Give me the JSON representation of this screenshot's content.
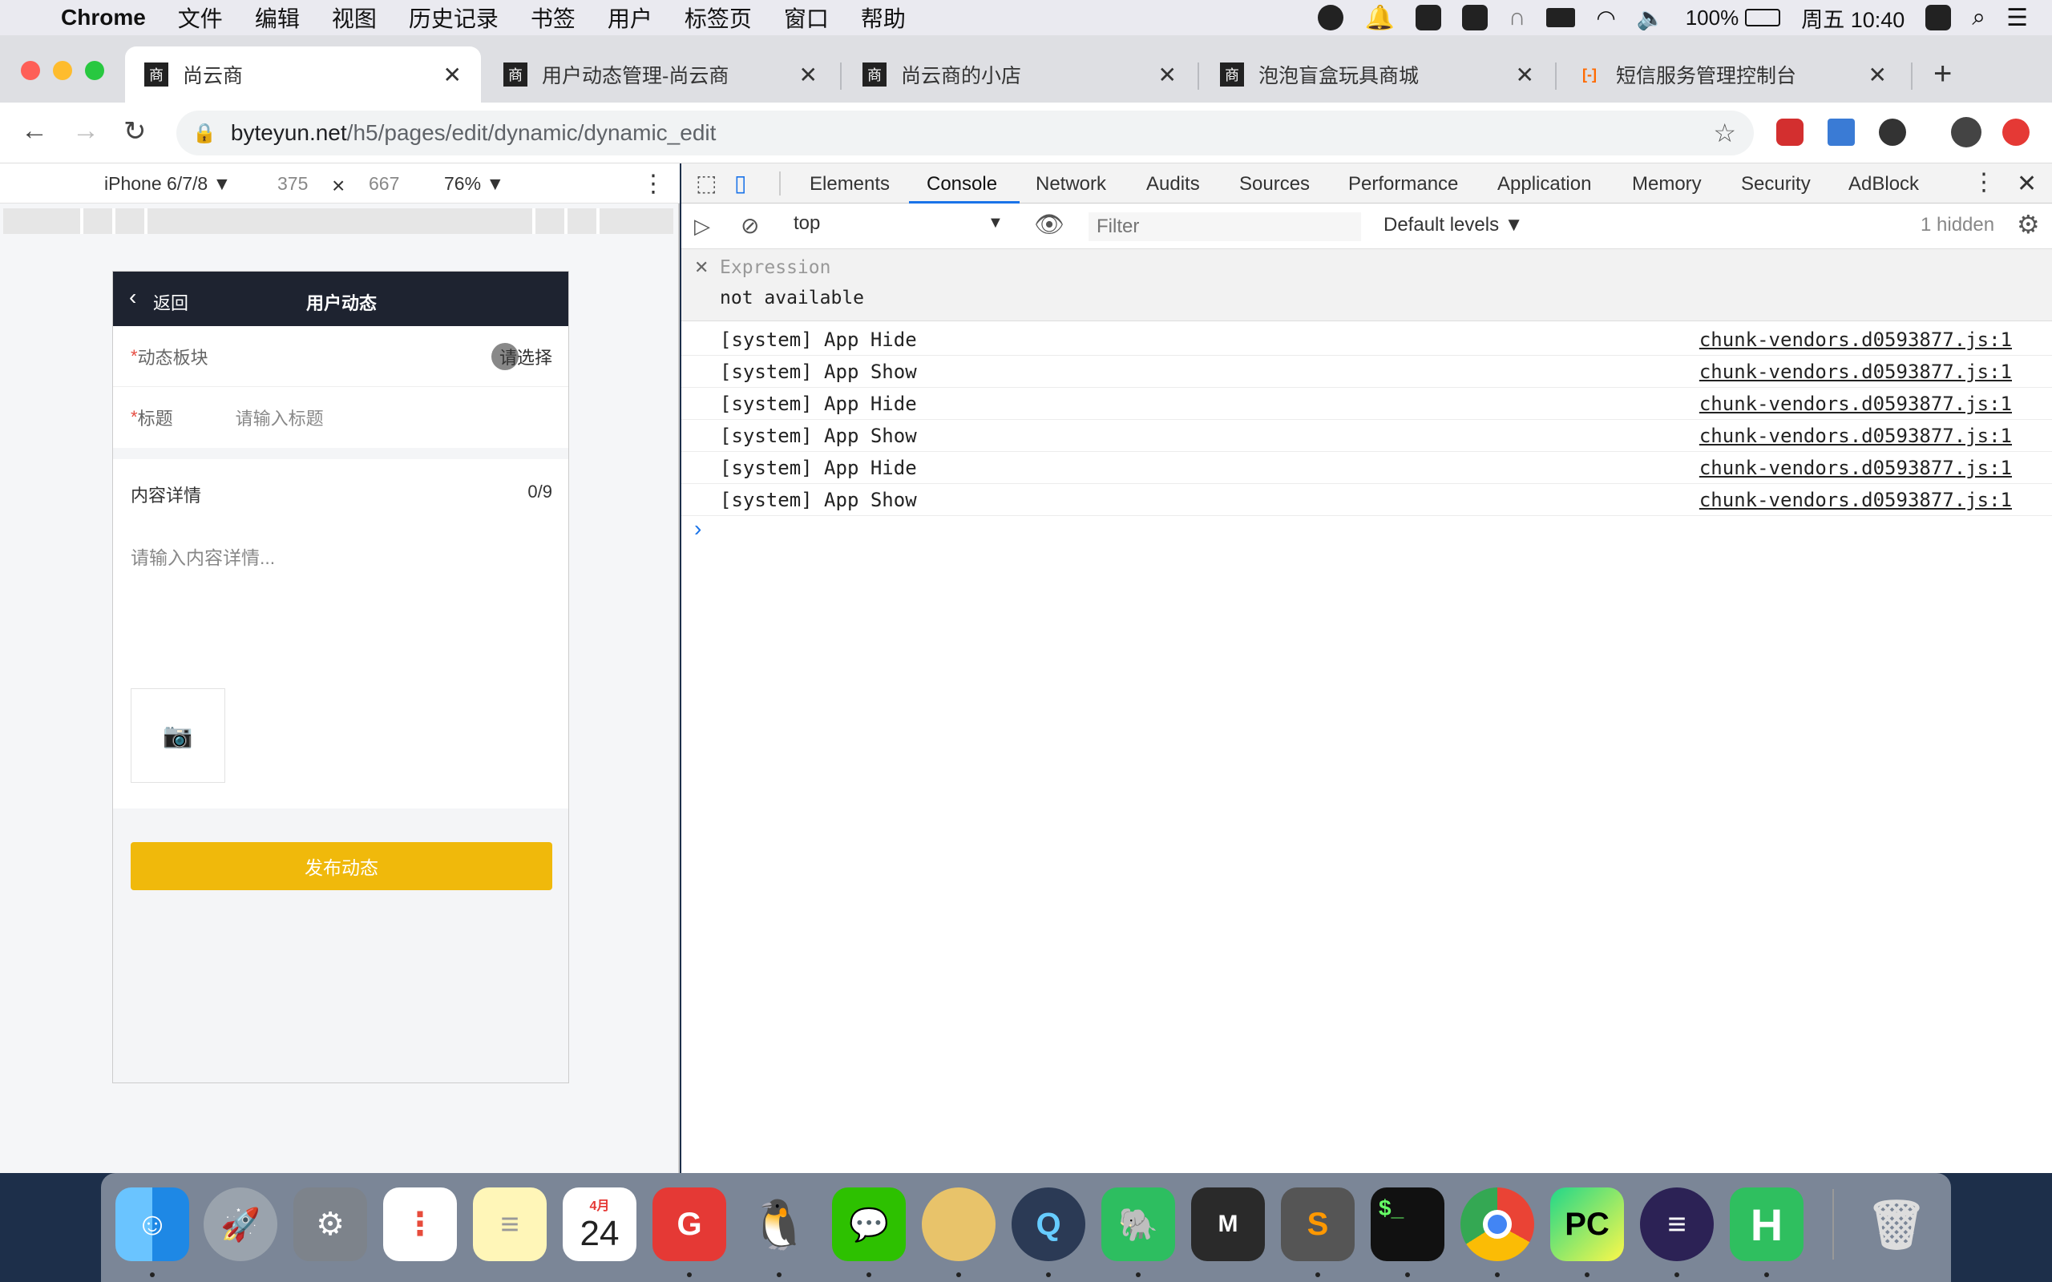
{
  "menubar": {
    "apple": "",
    "app": "Chrome",
    "items": [
      "文件",
      "编辑",
      "视图",
      "历史记录",
      "书签",
      "用户",
      "标签页",
      "窗口",
      "帮助"
    ],
    "battery": "100%",
    "clock": "周五 10:40"
  },
  "tabs": [
    {
      "title": "尚云商",
      "favicon": "商"
    },
    {
      "title": "用户动态管理-尚云商",
      "favicon": "商"
    },
    {
      "title": "尚云商的小店",
      "favicon": "商"
    },
    {
      "title": "泡泡盲盒玩具商城",
      "favicon": "商"
    },
    {
      "title": "短信服务管理控制台",
      "favicon": "[-]"
    }
  ],
  "url": {
    "host": "byteyun.net",
    "path": "/h5/pages/edit/dynamic/dynamic_edit"
  },
  "device_toolbar": {
    "device": "iPhone 6/7/8 ▼",
    "width": "375",
    "x": "×",
    "height": "667",
    "zoom": "76% ▼"
  },
  "phone": {
    "back": "返回",
    "title": "用户动态",
    "section_label": "动态板块",
    "section_value": "请选择",
    "title_label": "标题",
    "title_placeholder": "请输入标题",
    "content_label": "内容详情",
    "content_count": "0/9",
    "content_placeholder": "请输入内容详情...",
    "publish": "发布动态",
    "required": "*"
  },
  "devtools": {
    "tabs": [
      "Elements",
      "Console",
      "Network",
      "Audits",
      "Sources",
      "Performance",
      "Application",
      "Memory",
      "Security",
      "AdBlock"
    ],
    "active_tab": "Console",
    "context": "top",
    "filter_placeholder": "Filter",
    "levels": "Default levels ▼",
    "hidden": "1 hidden",
    "expression_label": "Expression",
    "expression_value": "not available",
    "logs": [
      {
        "msg": "[system] App Hide",
        "src": "chunk-vendors.d0593877.js:1"
      },
      {
        "msg": "[system] App Show",
        "src": "chunk-vendors.d0593877.js:1"
      },
      {
        "msg": "[system] App Hide",
        "src": "chunk-vendors.d0593877.js:1"
      },
      {
        "msg": "[system] App Show",
        "src": "chunk-vendors.d0593877.js:1"
      },
      {
        "msg": "[system] App Hide",
        "src": "chunk-vendors.d0593877.js:1"
      },
      {
        "msg": "[system] App Show",
        "src": "chunk-vendors.d0593877.js:1"
      }
    ],
    "prompt": "›"
  },
  "dock": {
    "calendar_month": "4月",
    "calendar_day": "24"
  },
  "colors": {
    "accent": "#1a73e8",
    "publish": "#f0b90b",
    "navbar": "#1e2330",
    "required": "#e54d42"
  }
}
